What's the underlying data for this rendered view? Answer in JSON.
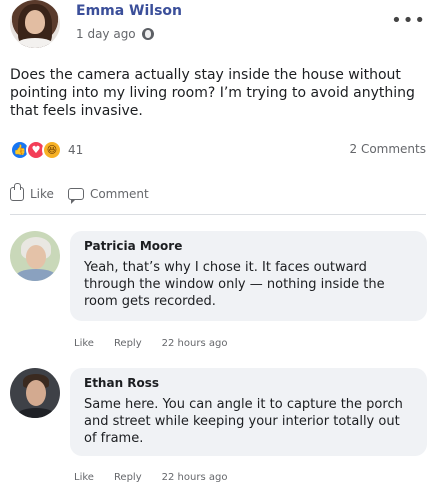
{
  "post": {
    "author": "Emma Wilson",
    "time": "1 day ago",
    "privacy_icon": "globe-icon",
    "more_icon": "•••",
    "text": "Does the camera actually stay inside the house without pointing into my living room? I’m trying to avoid anything that feels invasive.",
    "reaction_count": "41",
    "comment_count": "2 Comments",
    "reactions": [
      "like",
      "love",
      "haha"
    ]
  },
  "actions": {
    "like_label": "Like",
    "comment_label": "Comment"
  },
  "comments": [
    {
      "author": "Patricia Moore",
      "text": "Yeah, that’s why I chose it. It faces outward through the window only — nothing inside the room gets recorded.",
      "like_label": "Like",
      "reply_label": "Reply",
      "time": "22 hours ago"
    },
    {
      "author": "Ethan Ross",
      "text": "Same here. You can angle it to capture the porch and street while keeping your interior totally out of frame.",
      "like_label": "Like",
      "reply_label": "Reply",
      "time": "22 hours ago"
    }
  ],
  "colors": {
    "author_name": "#3b4f9a",
    "like_reaction": "#1877f2",
    "love_reaction": "#f33e58",
    "haha_reaction": "#f7b125",
    "bubble_bg": "#f0f2f5"
  }
}
